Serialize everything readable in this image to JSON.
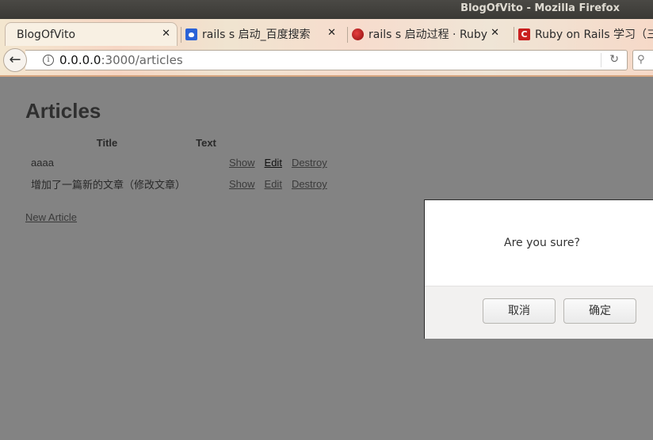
{
  "window": {
    "title": "BlogOfVito - Mozilla Firefox"
  },
  "tabs": [
    {
      "label": "BlogOfVito",
      "icon": "none",
      "active": true
    },
    {
      "label": "rails s 启动_百度搜索",
      "icon": "baidu-icon"
    },
    {
      "label": "rails s 启动过程 · Ruby",
      "icon": "ruby-icon"
    },
    {
      "label": "Ruby on Rails 学习（三",
      "icon": "csdn-icon"
    }
  ],
  "address": {
    "host": "0.0.0.0",
    "path": ":3000/articles"
  },
  "page": {
    "heading": "Articles",
    "table": {
      "headers": [
        "Title",
        "Text"
      ],
      "rows": [
        {
          "title": "aaaa",
          "text": "",
          "actions": [
            "Show",
            "Edit",
            "Destroy"
          ]
        },
        {
          "title": "增加了一篇新的文章（修改文章）",
          "text": "",
          "actions": [
            "Show",
            "Edit",
            "Destroy"
          ]
        }
      ]
    },
    "new_link": "New Article"
  },
  "dialog": {
    "message": "Are you sure?",
    "cancel": "取消",
    "ok": "确定"
  }
}
